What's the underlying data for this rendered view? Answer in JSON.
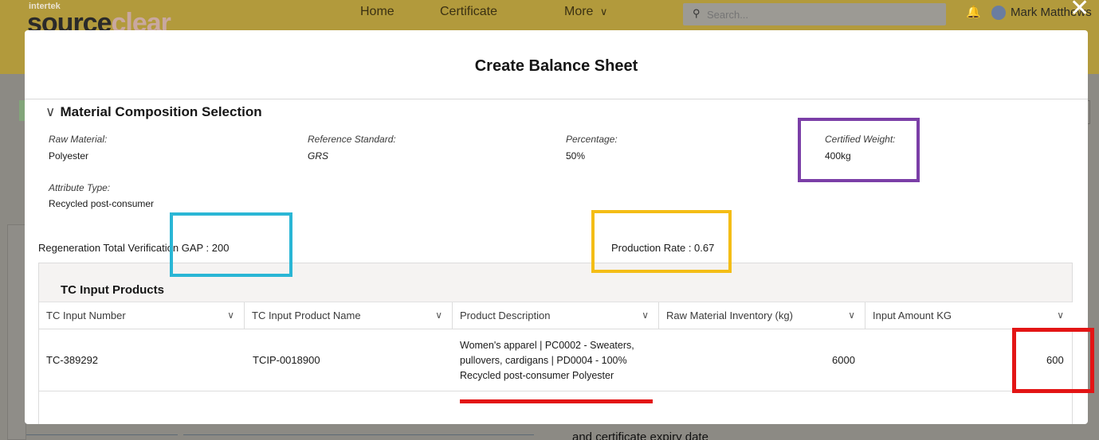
{
  "app": {
    "logo_top": "intertek",
    "logo_part1": "source",
    "logo_part2": "clear",
    "logo_tm": "™"
  },
  "nav": {
    "home": "Home",
    "certificate": "Certificate",
    "more": "More",
    "more_chevron": "∨"
  },
  "search": {
    "placeholder": "Search..."
  },
  "user": {
    "name": "Mark Matthews"
  },
  "modal": {
    "close": "✕",
    "title": "Create Balance Sheet",
    "section_title": "Material Composition Selection",
    "section_chevron": "∨",
    "fields": [
      {
        "label": "Raw Material:",
        "value": "Polyester"
      },
      {
        "label": "Reference Standard:",
        "value": "GRS"
      },
      {
        "label": "Percentage:",
        "value": "50%"
      },
      {
        "label": "Certified Weight:",
        "value": "400kg"
      },
      {
        "label": "Attribute Type:",
        "value": "Recycled post-consumer"
      }
    ],
    "gap_text": "Regeneration Total Verification GAP : 200",
    "rate_text": "Production Rate : 0.67"
  },
  "tc_input": {
    "title": "TC Input Products",
    "columns": [
      "TC Input Number",
      "TC Input Product Name",
      "Product Description",
      "Raw Material Inventory (kg)",
      "Input Amount KG"
    ],
    "dropdown_glyph": "∨",
    "rows": [
      {
        "number": "TC-389292",
        "product_name": "TCIP-0018900",
        "description": "Women's apparel | PC0002 - Sweaters, pullovers, cardigans | PD0004 - 100% Recycled post-consumer Polyester",
        "inventory": "6000",
        "input_amount": "600"
      }
    ]
  },
  "background": {
    "footer_text": "and certificate expiry date"
  },
  "annotation_colors": {
    "purple": "#7b3fa7",
    "blue": "#2ab6d5",
    "yellow": "#f4bd16",
    "red": "#e31515"
  }
}
